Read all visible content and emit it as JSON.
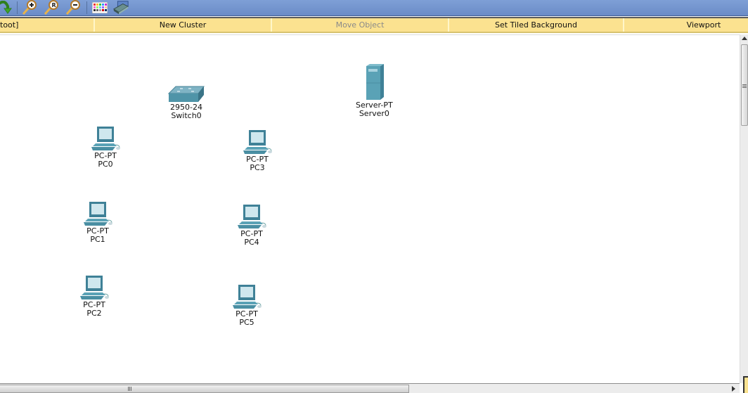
{
  "toolbar": {
    "buttons": [
      {
        "name": "back-arrow",
        "icon": "green-curved-arrow-icon"
      },
      {
        "name": "zoom-in",
        "icon": "zoom-in-icon"
      },
      {
        "name": "zoom-reset",
        "icon": "zoom-reset-icon"
      },
      {
        "name": "zoom-out",
        "icon": "zoom-out-icon"
      },
      {
        "name": "palette",
        "icon": "color-palette-icon"
      },
      {
        "name": "custom-device",
        "icon": "device-dialog-icon"
      }
    ]
  },
  "logical_bar": {
    "root_label": "[Root]",
    "root_visible": "toot]",
    "new_cluster": "New Cluster",
    "move_object": "Move Object",
    "set_tiled_background": "Set Tiled Background",
    "viewport": "Viewport"
  },
  "devices": [
    {
      "id": "switch0",
      "model": "2950-24",
      "name": "Switch0",
      "type": "switch"
    },
    {
      "id": "server0",
      "model": "Server-PT",
      "name": "Server0",
      "type": "server"
    },
    {
      "id": "pc0",
      "model": "PC-PT",
      "name": "PC0",
      "type": "pc"
    },
    {
      "id": "pc1",
      "model": "PC-PT",
      "name": "PC1",
      "type": "pc"
    },
    {
      "id": "pc2",
      "model": "PC-PT",
      "name": "PC2",
      "type": "pc"
    },
    {
      "id": "pc3",
      "model": "PC-PT",
      "name": "PC3",
      "type": "pc"
    },
    {
      "id": "pc4",
      "model": "PC-PT",
      "name": "PC4",
      "type": "pc"
    },
    {
      "id": "pc5",
      "model": "PC-PT",
      "name": "PC5",
      "type": "pc"
    }
  ],
  "colors": {
    "toolbar_blue": "#7395d1",
    "logical_bar_yellow": "#fbe290",
    "device_teal": "#4a9bb0"
  }
}
